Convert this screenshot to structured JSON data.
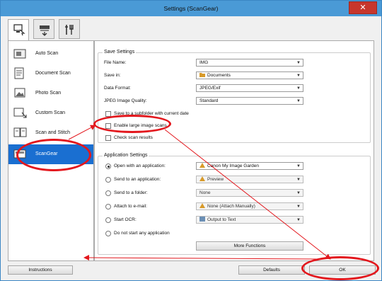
{
  "window": {
    "title": "Settings (ScanGear)",
    "close_glyph": "✕"
  },
  "tabs": [
    {
      "icon": "scan-from-computer-icon",
      "active": true
    },
    {
      "icon": "scan-from-panel-icon",
      "active": false
    },
    {
      "icon": "general-settings-icon",
      "active": false
    }
  ],
  "sidebar": {
    "items": [
      {
        "label": "Auto Scan",
        "icon": "auto-scan-icon"
      },
      {
        "label": "Document Scan",
        "icon": "document-scan-icon"
      },
      {
        "label": "Photo Scan",
        "icon": "photo-scan-icon"
      },
      {
        "label": "Custom Scan",
        "icon": "custom-scan-icon"
      },
      {
        "label": "Scan and Stitch",
        "icon": "scan-and-stitch-icon"
      },
      {
        "label": "ScanGear",
        "icon": "scangear-icon",
        "active": true
      }
    ]
  },
  "save_settings": {
    "title": "Save Settings",
    "file_name_label": "File Name:",
    "file_name_value": "IMG",
    "save_in_label": "Save in:",
    "save_in_value": "Documents",
    "data_format_label": "Data Format:",
    "data_format_value": "JPEG/Exif",
    "jpeg_quality_label": "JPEG Image Quality:",
    "jpeg_quality_value": "Standard",
    "subfolder_label": "Save to a subfolder with current date",
    "large_scans_label": "Enable large image scans",
    "check_results_label": "Check scan results"
  },
  "app_settings": {
    "title": "Application Settings",
    "open_app_label": "Open with an application:",
    "open_app_value": "Canon My Image Garden",
    "send_app_label": "Send to an application:",
    "send_app_value": "Preview",
    "send_folder_label": "Send to a folder:",
    "send_folder_value": "None",
    "email_label": "Attach to e-mail:",
    "email_value": "None (Attach Manually)",
    "ocr_label": "Start OCR:",
    "ocr_value": "Output to Text",
    "no_app_label": "Do not start any application",
    "more_functions_label": "More Functions"
  },
  "footer": {
    "instructions_label": "Instructions",
    "defaults_label": "Defaults",
    "ok_label": "OK"
  },
  "colors": {
    "annotation": "#e3171d",
    "sidebar_active": "#1a6fd1",
    "titlebar": "#4a9ad6"
  }
}
